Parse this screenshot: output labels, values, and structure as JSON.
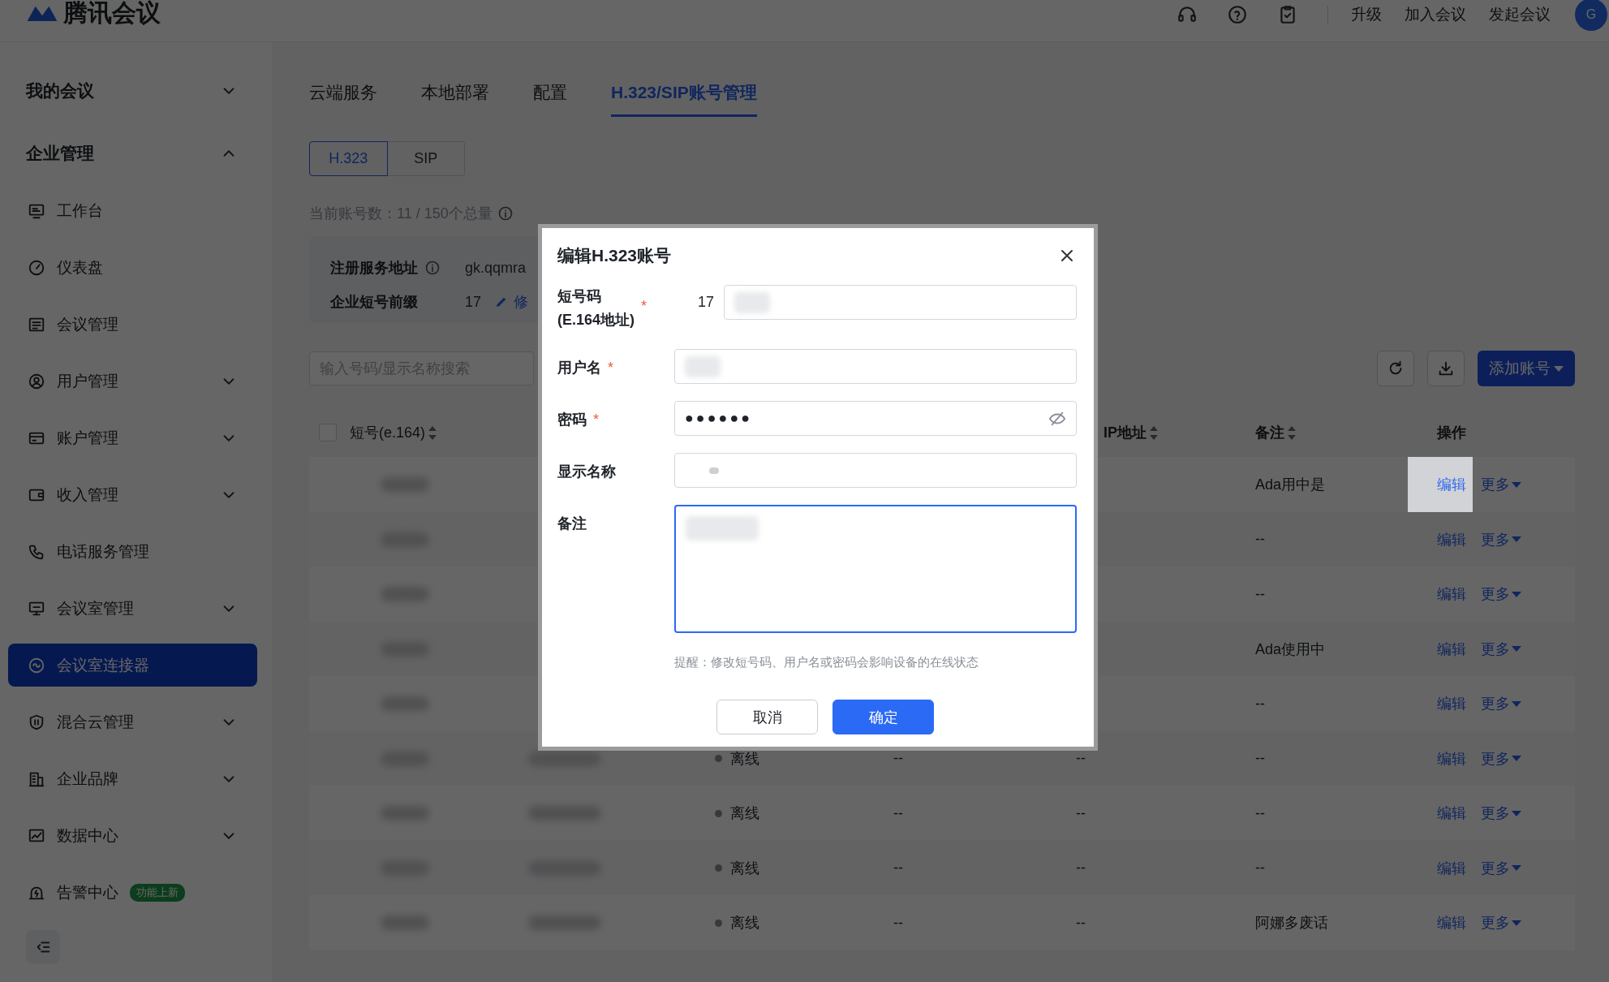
{
  "app": {
    "name": "腾讯会议"
  },
  "top_links": [
    "升级",
    "加入会议",
    "发起会议"
  ],
  "avatar": "G",
  "sidebar": {
    "sections": [
      {
        "label": "我的会议",
        "expanded": false
      },
      {
        "label": "企业管理",
        "expanded": true,
        "items": [
          {
            "label": "工作台",
            "kind": "link",
            "selected": false
          },
          {
            "label": "仪表盘",
            "kind": "link",
            "selected": false
          },
          {
            "label": "会议管理",
            "kind": "link",
            "selected": false
          },
          {
            "label": "用户管理",
            "kind": "group",
            "expanded": false,
            "selected": false
          },
          {
            "label": "账户管理",
            "kind": "group",
            "expanded": false,
            "selected": false
          },
          {
            "label": "收入管理",
            "kind": "group",
            "expanded": false,
            "selected": false
          },
          {
            "label": "电话服务管理",
            "kind": "link",
            "selected": false
          },
          {
            "label": "会议室管理",
            "kind": "group",
            "expanded": false,
            "selected": false
          },
          {
            "label": "会议室连接器",
            "kind": "link",
            "selected": true
          },
          {
            "label": "混合云管理",
            "kind": "group",
            "expanded": false,
            "selected": false
          },
          {
            "label": "企业品牌",
            "kind": "group",
            "expanded": false,
            "selected": false
          },
          {
            "label": "数据中心",
            "kind": "group",
            "expanded": false,
            "selected": false
          },
          {
            "label": "告警中心",
            "kind": "link",
            "selected": false,
            "badge": "功能上新"
          }
        ]
      }
    ]
  },
  "tabs": [
    {
      "label": "云端服务",
      "selected": false
    },
    {
      "label": "本地部署",
      "selected": false
    },
    {
      "label": "配置",
      "selected": false
    },
    {
      "label": "H.323/SIP账号管理",
      "selected": true
    }
  ],
  "protocol_switch": [
    {
      "label": "H.323",
      "selected": true
    },
    {
      "label": "SIP",
      "selected": false
    }
  ],
  "account_count": "当前账号数：11 / 150个总量",
  "info_panel": {
    "rows": [
      {
        "label": "注册服务地址",
        "info": true,
        "value": "gk.qqmra"
      },
      {
        "label": "企业短号前缀",
        "info": false,
        "value": "17",
        "edit_link": "修"
      }
    ]
  },
  "search": {
    "placeholder": "输入号码/显示名称搜索"
  },
  "add_button": {
    "label": "添加账号"
  },
  "table": {
    "header_checked": false,
    "columns": [
      {
        "kind": "number",
        "label": "短号(e.164)",
        "sortable": true
      },
      {
        "kind": "ip",
        "label": "IP地址",
        "sortable": true
      },
      {
        "kind": "remark",
        "label": "备注",
        "sortable": true
      },
      {
        "kind": "actions",
        "label": "操作",
        "sortable": false
      }
    ],
    "rows": [
      {
        "redacted": true,
        "remark": "Ada用中是",
        "edit": "编辑",
        "more": "更多",
        "edit_highlighted": true
      },
      {
        "redacted": true,
        "remark": "--",
        "edit": "编辑",
        "more": "更多",
        "edit_highlighted": false
      },
      {
        "redacted": true,
        "remark": "--",
        "edit": "编辑",
        "more": "更多",
        "edit_highlighted": false
      },
      {
        "redacted": true,
        "remark": "Ada使用中",
        "edit": "编辑",
        "more": "更多",
        "edit_highlighted": false
      },
      {
        "redacted": true,
        "remark": "--",
        "edit": "编辑",
        "more": "更多",
        "edit_highlighted": false
      },
      {
        "redacted": true,
        "name_redacted": true,
        "status": "离线",
        "column_4": "--",
        "ip": "--",
        "remark": "--",
        "edit": "编辑",
        "more": "更多",
        "edit_highlighted": false
      },
      {
        "redacted": true,
        "name_redacted": true,
        "status": "离线",
        "column_4": "--",
        "ip": "--",
        "remark": "--",
        "edit": "编辑",
        "more": "更多",
        "edit_highlighted": false
      },
      {
        "redacted": true,
        "name_redacted": true,
        "status": "离线",
        "column_4": "--",
        "ip": "--",
        "remark": "--",
        "edit": "编辑",
        "more": "更多",
        "edit_highlighted": false
      },
      {
        "redacted": true,
        "name_redacted": true,
        "status": "离线",
        "column_4": "--",
        "ip": "--",
        "remark": "阿娜多废话",
        "edit": "编辑",
        "more": "更多",
        "edit_highlighted": false
      }
    ]
  },
  "dialog": {
    "title": "编辑H.323账号",
    "fields": [
      {
        "kind": "prefixed",
        "label": "短号码",
        "label_note": "(E.164地址)",
        "required_mark": "*",
        "prefix": "17",
        "redacted": true,
        "focused": false
      },
      {
        "kind": "text",
        "label": "用户名",
        "required_mark": "*",
        "redacted": true,
        "focused": false
      },
      {
        "kind": "password",
        "label": "密码",
        "required_mark": "*",
        "value": "●●●●●●",
        "redacted": false,
        "focused": false
      },
      {
        "kind": "text",
        "label": "显示名称",
        "redacted": true,
        "focused": false
      },
      {
        "kind": "textarea",
        "label": "备注",
        "redacted": true,
        "focused": true
      }
    ],
    "hint": "提醒：修改短号码、用户名或密码会影响设备的在线状态",
    "buttons": [
      {
        "label": "取消",
        "primary": false
      },
      {
        "label": "确定",
        "primary": true
      }
    ]
  }
}
